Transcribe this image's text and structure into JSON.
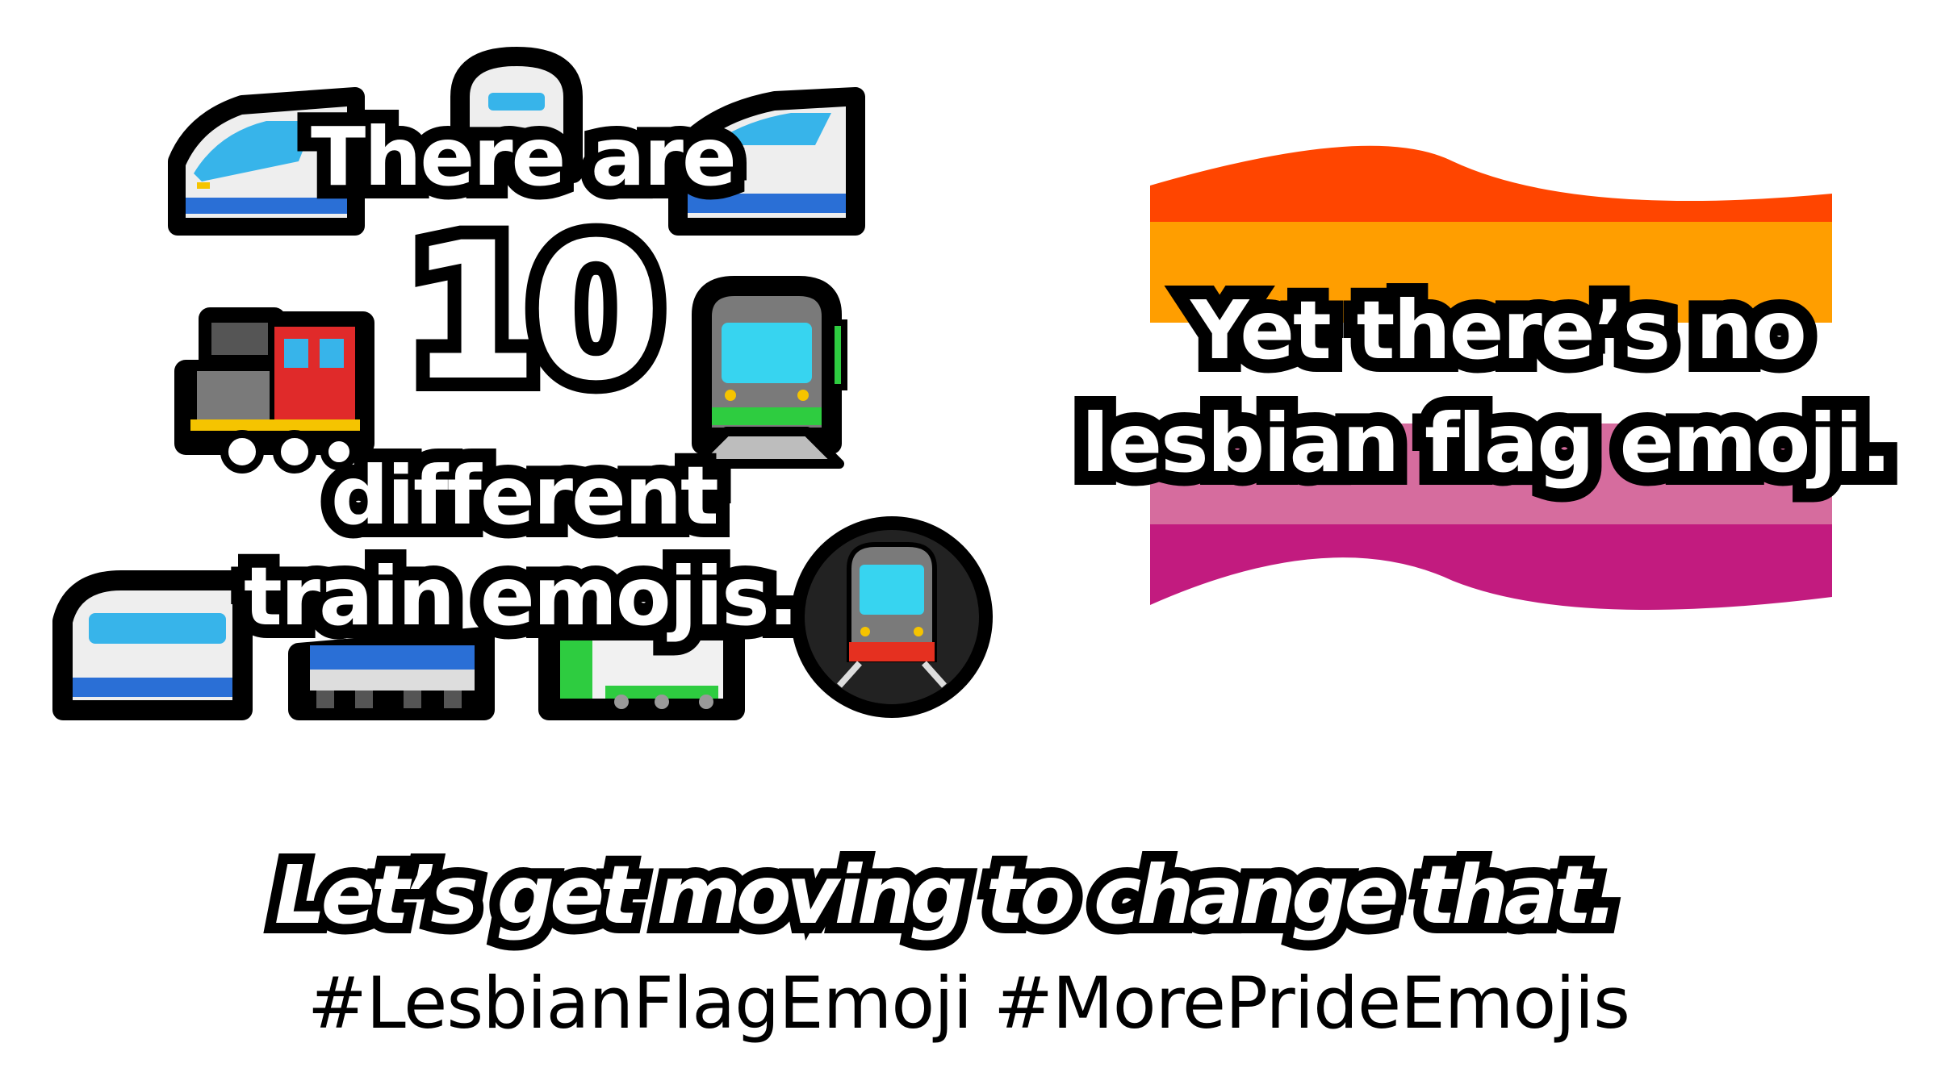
{
  "left_panel": {
    "line1": "There are",
    "number": "10",
    "line3": "different",
    "line4": "train emojis."
  },
  "right_panel": {
    "line1": "Yet there’s no",
    "line2": "lesbian flag emoji."
  },
  "footer": {
    "slogan": "Let’s get moving to change that.",
    "hashtags": "#LesbianFlagEmoji #MorePrideEmojis"
  },
  "icons": [
    "high-speed-train-icon",
    "bullet-train-icon",
    "train-front-icon",
    "locomotive-icon",
    "light-rail-icon",
    "railway-car-icon",
    "monorail-icon",
    "tram-icon",
    "metro-icon",
    "lesbian-flag-icon"
  ],
  "flag_colors": [
    "#FF4500",
    "#FF9E00",
    "#FFFFFF",
    "#D66C9E",
    "#C21B7F"
  ]
}
